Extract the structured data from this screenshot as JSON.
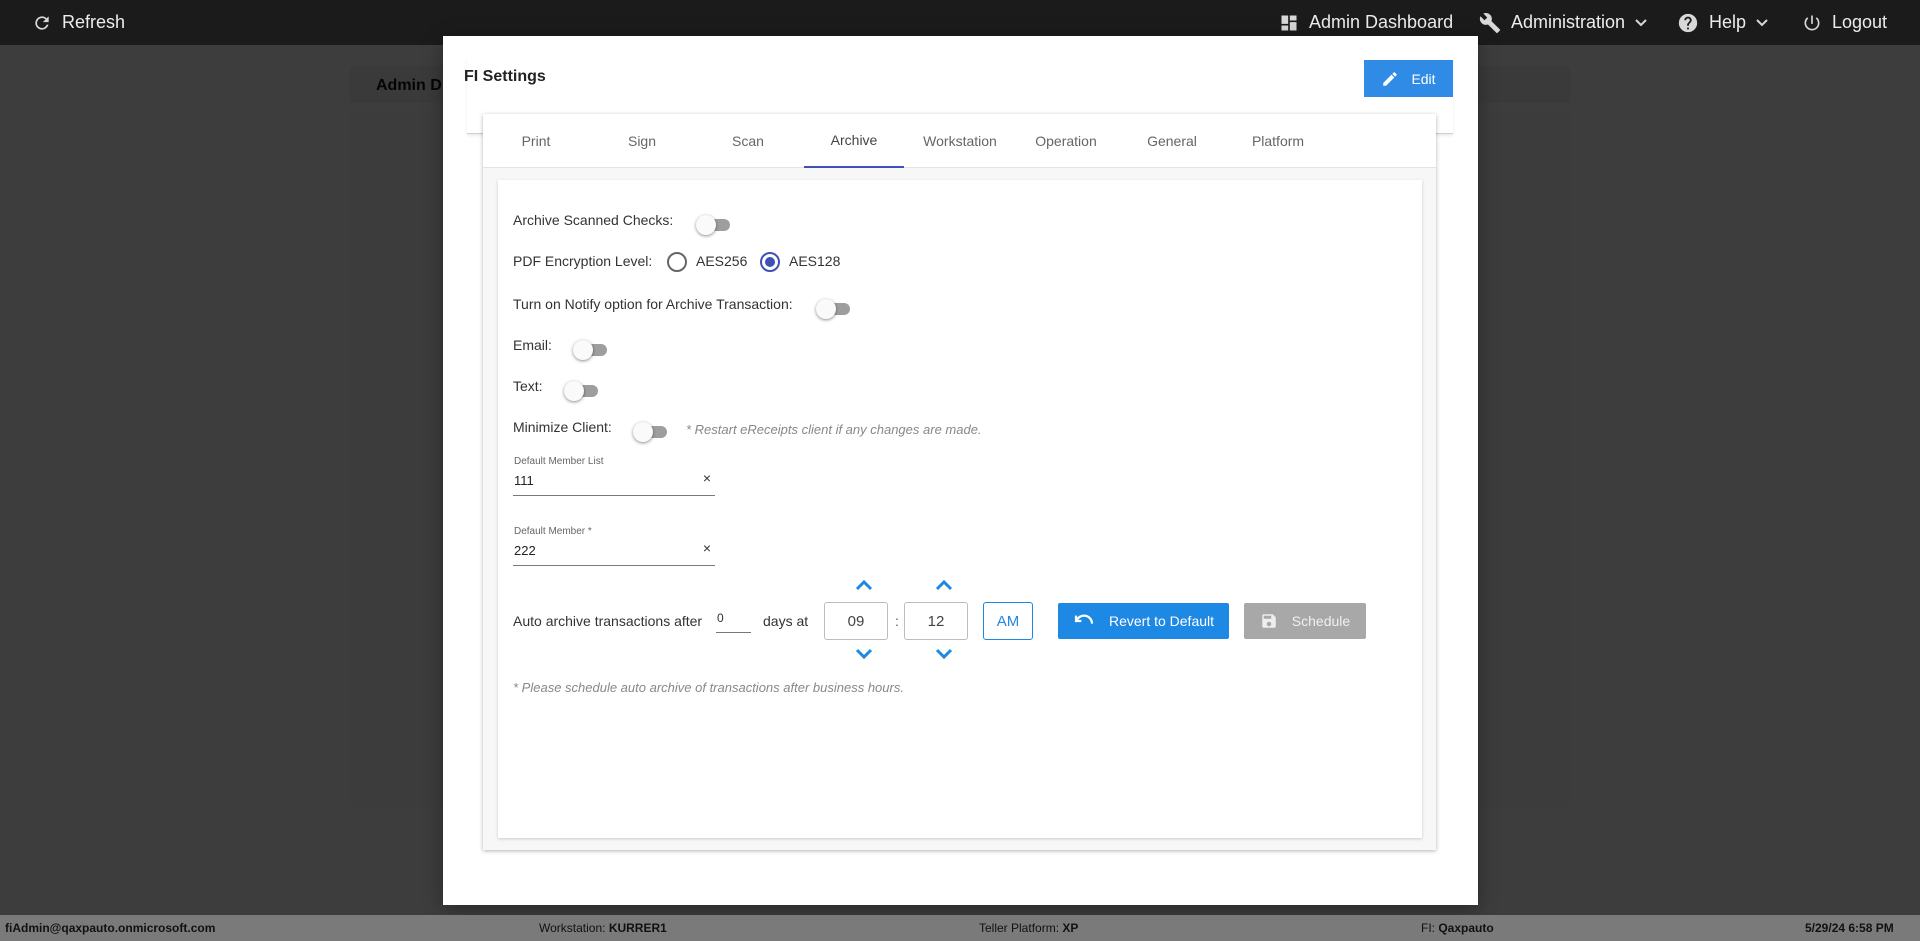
{
  "topbar": {
    "refresh_label": "Refresh",
    "admin_dashboard_label": "Admin Dashboard",
    "administration_label": "Administration",
    "help_label": "Help",
    "logout_label": "Logout"
  },
  "background": {
    "card_title": "Admin D"
  },
  "modal": {
    "title": "FI Settings",
    "edit_label": "Edit",
    "tabs": [
      {
        "label": "Print"
      },
      {
        "label": "Sign"
      },
      {
        "label": "Scan"
      },
      {
        "label": "Archive",
        "active": true
      },
      {
        "label": "Workstation"
      },
      {
        "label": "Operation"
      },
      {
        "label": "General"
      },
      {
        "label": "Platform"
      }
    ]
  },
  "archive": {
    "archive_scanned_checks_label": "Archive Scanned Checks:",
    "archive_scanned_checks_on": false,
    "pdf_encryption_label": "PDF Encryption Level:",
    "encryption_options": [
      "AES256",
      "AES128"
    ],
    "encryption_selected": "AES128",
    "notify_label": "Turn on Notify option for Archive Transaction:",
    "notify_on": false,
    "email_label": "Email:",
    "email_on": false,
    "text_label": "Text:",
    "text_on": false,
    "minimize_client_label": "Minimize Client:",
    "minimize_client_on": false,
    "restart_hint": "* Restart eReceipts client if any changes are made.",
    "default_member_list_label": "Default Member List",
    "default_member_list_value": "111",
    "default_member_label": "Default Member *",
    "default_member_value": "222",
    "clear_symbol": "×",
    "auto_archive_prefix": "Auto archive transactions after",
    "auto_archive_days": "0",
    "days_at_label": "days at",
    "hour": "09",
    "time_separator": ":",
    "minute": "12",
    "ampm": "AM",
    "revert_label": "Revert to Default",
    "schedule_label": "Schedule",
    "schedule_hint": "* Please schedule auto archive of transactions after business hours."
  },
  "statusbar": {
    "user": "fiAdmin@qaxpauto.onmicrosoft.com",
    "workstation_label": "Workstation:",
    "workstation_value": "KURRER1",
    "teller_platform_label": "Teller Platform:",
    "teller_platform_value": "XP",
    "fi_label": "FI:",
    "fi_value": "Qaxpauto",
    "datetime": "5/29/24 6:58 PM"
  },
  "colors": {
    "accent": "#1e88e5",
    "tab_indicator": "#3f51b5",
    "topbar": "#1b1b1b"
  },
  "icons": [
    "refresh-icon",
    "dashboard-icon",
    "wrench-icon",
    "help-icon",
    "power-icon",
    "pencil-icon",
    "undo-icon",
    "save-icon",
    "chevron-up-icon",
    "chevron-down-icon"
  ]
}
